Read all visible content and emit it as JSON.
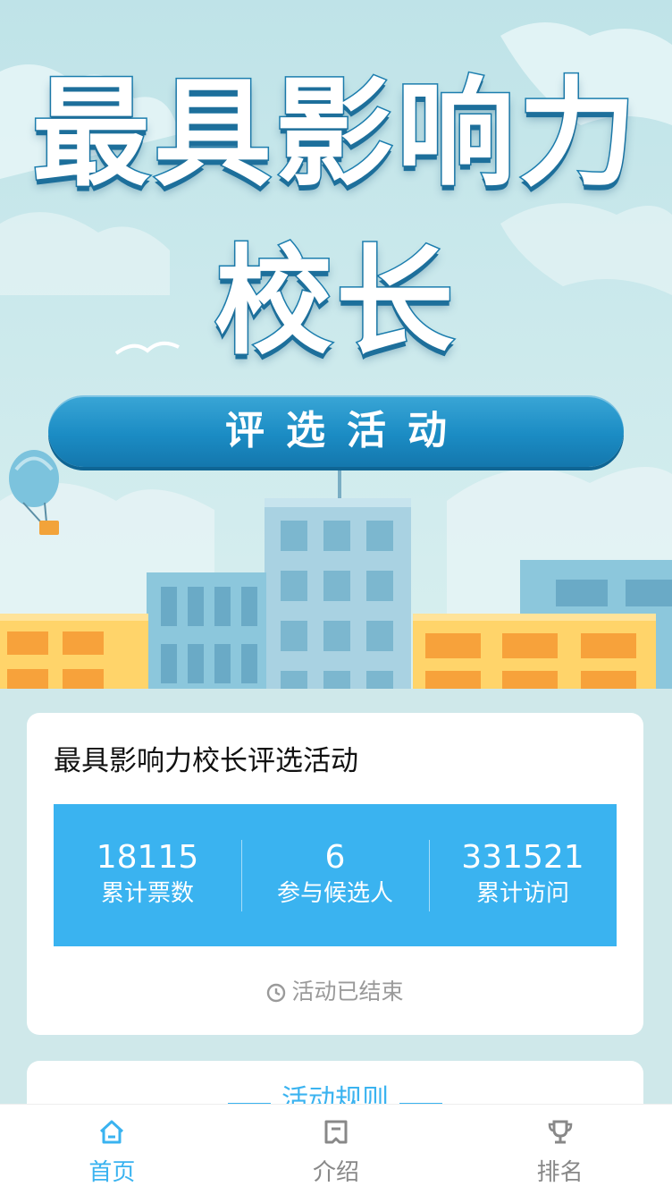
{
  "banner": {
    "title_line1": "最具影响力",
    "title_line2": "校长",
    "subtitle": "评选活动"
  },
  "info": {
    "title": "最具影响力校长评选活动",
    "stats": [
      {
        "value": "18115",
        "label": "累计票数"
      },
      {
        "value": "6",
        "label": "参与候选人"
      },
      {
        "value": "331521",
        "label": "累计访问"
      }
    ],
    "status": "活动已结束"
  },
  "rules": {
    "heading": "活动规则"
  },
  "tabbar": {
    "items": [
      {
        "label": "首页",
        "icon": "home-icon",
        "active": true
      },
      {
        "label": "介绍",
        "icon": "info-icon",
        "active": false
      },
      {
        "label": "排名",
        "icon": "trophy-icon",
        "active": false
      }
    ]
  },
  "colors": {
    "accent": "#3ab3f0",
    "banner_blue": "#1b8cc4",
    "muted": "#9a9a9a"
  }
}
